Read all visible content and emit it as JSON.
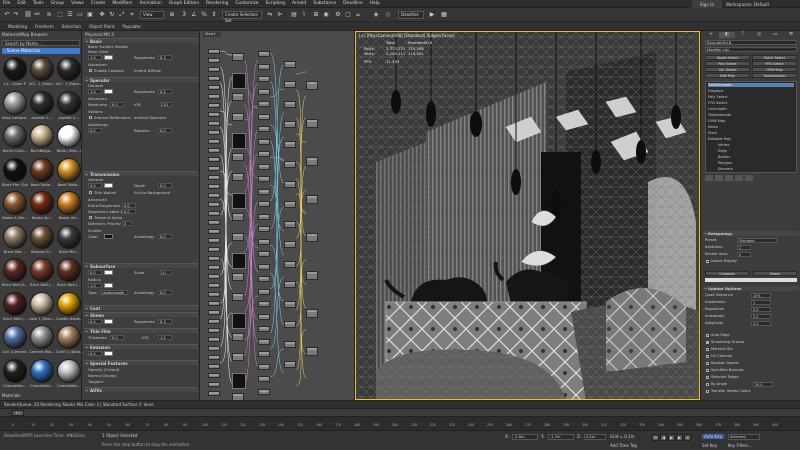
{
  "menu": [
    "File",
    "Edit",
    "Tools",
    "Group",
    "Views",
    "Create",
    "Modifiers",
    "Animation",
    "Graph Editors",
    "Rendering",
    "Customize",
    "Scripting",
    "Arnold",
    "Substance",
    "Deadline",
    "Help"
  ],
  "signin": "Sign In",
  "workspace": "Workspaces: Default",
  "toolbar": {
    "selection_set": "Create Selection Set",
    "view": "View",
    "deadline": "Deadline"
  },
  "ribbon": [
    "Modeling",
    "Freeform",
    "Selection",
    "Object Paint",
    "Populate"
  ],
  "browser": {
    "title": "Material/Map Browser",
    "search": "Search by Name ...",
    "library": "- Scene Materials",
    "swatches": [
      "LX - Outer P",
      "ACI - 1 (Rock...)",
      "ACI - 2 (Rock...)",
      "Alloy Lampsh...",
      "asphalt 2 ...",
      "asphalt 4 ...",
      "Bench Conc...",
      "BirchBeige...",
      "Birds ( Bird...)",
      "Black Pier Cloth",
      "Book Table...",
      "Book Table...",
      "Books A (Mo...",
      "Books Sp...",
      "Books Vol...",
      "Brass Mat ...",
      "Brasses El...",
      "Brick Mix...",
      "Brick Wall (S...",
      "Brick Wall (...",
      "Brick Wall (...",
      "Brick Wall (...",
      "cake 1 (Bran...",
      "Candle Holde...",
      "Ceil. (Cement...",
      "Cement Wal...",
      "Chair C (Dela...",
      "Chandellen...",
      "Chandellen...",
      "Chandellen..."
    ],
    "footer": "Materials"
  },
  "params": {
    "title": "Physical Mtl 3",
    "basic_label": "Basic",
    "preset": "Basic Surface Models",
    "base_color_label": "Base Color",
    "base_color_value": "1.0",
    "roughness_label": "Roughness",
    "roughness_value": "0.3",
    "advanced_label": "Advanced",
    "fresnel_label": "Enable Caustics",
    "thin_walled_label": "Inherit Diffuse",
    "specular_label": "Specular",
    "general_label": "General",
    "spec_value": "1.0",
    "spec_rough_label": "Roughness",
    "spec_rough_value": "0.2",
    "metal_label": "Metalness",
    "metal_value": "0.0",
    "ior_label": "IOR",
    "ior_value": "1.52",
    "anisotropy_label": "Anisotropy",
    "aniso_value": "0.0",
    "rotation_label": "Rotation",
    "rotation_value": "0.0",
    "options_label": "Options",
    "opt1": "Internal Reflections",
    "opt2": "Indirect Specular",
    "transmission_label": "Transmission",
    "trans_general": "General",
    "trans_value": "0.0",
    "depth_label": "Depth",
    "depth_value": "0.0",
    "thin_label": "Thin Walled",
    "exit_label": "Exit to Background",
    "trans_adv": "Advanced",
    "extra_rough_label": "Extra Roughness",
    "extra_rough_value": "0.0",
    "disp_label": "Dispersion Abbe #",
    "disp_value": "0.0",
    "tangent_label": "Transmit Alpha",
    "dielectric_label": "Dielectric Priority",
    "dielectric_value": "0",
    "scatter_label": "Scatter",
    "scatter_color_label": "Color",
    "scatter_aniso_label": "Anisotropy",
    "scatter_aniso_value": "0.0",
    "subsurface_label": "Subsurface",
    "ss_value": "0.0",
    "ss_scale_label": "Scale",
    "ss_scale_value": "1.0",
    "radius_label": "Radius",
    "radius_value": "1.0",
    "type_label": "Type",
    "type_value": "randomwalk",
    "ss_aniso_label": "Anisotropy",
    "ss_aniso_value": "0.0",
    "coat_label": "Coat",
    "sheen_label": "Sheen",
    "sheen_value": "0.0",
    "sheen_rough_label": "Roughness",
    "sheen_rough_value": "0.3",
    "thinfilm_label": "Thin Film",
    "thickness_label": "Thickness",
    "thickness_value": "0.0",
    "thin_ior_label": "IOR",
    "thin_ior_value": "1.5",
    "emission_label": "Emission",
    "emission_value": "0.0",
    "special_label": "Special Features",
    "opacity_label": "Opacity (Cutout)",
    "normal_label": "Normal (Bump)",
    "tangent2_label": "Tangent",
    "aovs_label": "AOVs"
  },
  "slate": {
    "tab": "View1"
  },
  "viewport": {
    "label": "[+] [PhysCamera008] [Standard] [Edged Faces]",
    "stats": {
      "header_sel": "Rounded018",
      "total_label": "Total",
      "polys_label": "Polys:",
      "polys_total": "2,373,231",
      "polys_sel": "119,548",
      "verts_label": "Verts:",
      "verts_total": "2,200,211",
      "verts_sel": "119,501",
      "fps_label": "FPS:",
      "fps": "11.433"
    }
  },
  "cmd": {
    "object_name": "Rounded018",
    "modifier_list": "Modifier List",
    "buttons": [
      "Noise Select",
      "Patch Select",
      "Poly Select",
      "FFD Select",
      "Vol. Select",
      "UVW Map",
      "Edit Poly",
      "TurboSmooth"
    ],
    "stack": [
      "TurboSmooth",
      "Displace",
      "Poly Select",
      "FFD Select",
      "UnSmooth",
      "Turbosmooth",
      "UVW Map",
      "Relax",
      "Shell",
      "Editable Poly",
      "Vertex",
      "Edge",
      "Border",
      "Polygon",
      "Element"
    ],
    "turbosmooth_label": "TurboSmooth",
    "main_label": "Main",
    "iterations_label": "Iterations:",
    "iterations_value": "2",
    "render_iters_label": "Render Iters:",
    "render_iters_value": "0",
    "isoline_label": "Isoline Display",
    "explicit_label": "Explicit Normals",
    "surface_label": "Surface Parameters",
    "smooth_result_label": "Smooth Result",
    "sep_label": "Separate by:",
    "mat_label": "Materials",
    "sg_label": "Smoothing Groups",
    "update_label": "Update Options",
    "always_label": "Always",
    "when_rendering_label": "When Rendering",
    "manually_label": "Manually",
    "update_btn": "Update",
    "ws_label": "Retopology",
    "ws_rows": [
      [
        "Quad Tolerance",
        "10%"
      ],
      [
        "Subdivision",
        "1"
      ],
      [
        "Regularize",
        "0.5"
      ],
      [
        "Anisotropy",
        "0.5"
      ],
      [
        "Adaptivity",
        "0.3"
      ]
    ],
    "preset_label": "Preset:",
    "preset_value": "Standard",
    "compute_btn": "Compute",
    "reset_btn": "Reset",
    "auto_edge": "Auto Edge",
    "smooth_groups": "Smoothing Groups",
    "mat_id": "Material IDs",
    "uv_channel": "UV Channel",
    "boolean": "Boolean Seams",
    "spec_norm": "Specified Normals",
    "selected_edges": "Selected Edges",
    "by_angle": "By Angle",
    "by_angle_value": "30.0",
    "transfer": "Transfer Vertex Colors",
    "output_label": "Output",
    "output_value": "Retopology Mesh"
  },
  "status1": "RenderQueue: 20  Rendering 'Books Mix Color 3 | Standard Surface 1' done",
  "timeslider": "0 / 100",
  "track_ticks": [
    "0",
    "10",
    "20",
    "30",
    "40",
    "50",
    "60",
    "70",
    "80",
    "90",
    "100",
    "110",
    "120",
    "130",
    "140",
    "150",
    "160",
    "170",
    "180",
    "190",
    "200",
    "210",
    "220",
    "230",
    "240",
    "250",
    "260",
    "270",
    "280",
    "290",
    "300",
    "310",
    "320",
    "330",
    "340",
    "350",
    "360",
    "370",
    "380",
    "390",
    "400"
  ],
  "status2": {
    "script": "DeadlineSMTP Launcher Time: #NOZero",
    "selected": "1 Object Selected",
    "hint": "Press the stop button to stop the animation",
    "x_label": "X:",
    "x_value": "-2.6m",
    "y_label": "Y:",
    "y_value": "-1.7m",
    "z_label": "Z:",
    "z_value": "0.0m",
    "grid": "Grid = 0.1m",
    "add_tag": "Add Time Tag",
    "autokey": "Auto Key",
    "setkey": "Set Key",
    "selected_dd": "Selected",
    "key_filters": "Key Filters..."
  }
}
